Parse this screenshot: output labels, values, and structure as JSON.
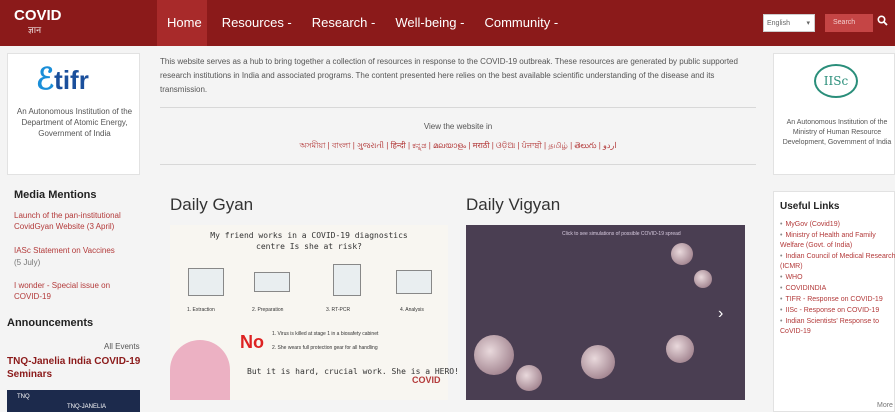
{
  "logo": {
    "text": "COVID",
    "sub": "ज्ञान"
  },
  "nav": {
    "items": [
      "Home",
      "Resources -",
      "Research -",
      "Well-being -",
      "Community -"
    ]
  },
  "header": {
    "language": "English",
    "search_placeholder": "Search",
    "search_icon": "search-icon"
  },
  "tifr": {
    "brand": "tifr",
    "description": "An Autonomous Institution of the Department of Atomic Energy, Government of India"
  },
  "media": {
    "title": "Media Mentions",
    "item1": "Launch of the pan-institutional CovidGyan Website (3 April)",
    "item2": "IASc Statement on Vaccines",
    "item2_date": "(5 July)",
    "item3": "I wonder - Special issue on COVID-19"
  },
  "announcements": {
    "title": "Announcements",
    "all_events": "All Events",
    "seminar": "TNQ-Janelia India COVID-19 Seminars",
    "banner_tnq": "TNQ",
    "banner_janelia": "TNQ-JANELIA"
  },
  "intro": "This website serves as a hub to bring together a collection of resources in response to the COVID-19 outbreak. These resources are generated by public supported research institutions in India and associated programs. The content presented here relies on the best available scientific understanding of the disease and its transmission.",
  "view_label": "View the website in",
  "languages": "অসমীয়া | বাংলা | ગુજરાતી | हिन्दी | ಕನ್ನಡ | മലയാളം | मराठी | ଓଡ଼ିଆ | ਪੰਜਾਬੀ | தமிழ் | తెలుగు | اردو",
  "daily_gyan": {
    "title": "Daily Gyan",
    "question": "My friend works in a COVID-19 diagnostics centre Is she at risk?",
    "steps": [
      "1. Extraction",
      "2. Preparation",
      "3. RT-PCR",
      "4. Analysis"
    ],
    "no": "No",
    "bullet1": "1. Virus is killed at stage 1 in a biosafety cabinet",
    "bullet2": "2. She wears full protection gear for all handling",
    "hero": "But it is hard, crucial work. She is a HERO!",
    "logo": "COVID"
  },
  "daily_vigyan": {
    "title": "Daily Vigyan",
    "caption": "Click to see simulations of possible COVID-19 spread"
  },
  "iisc": {
    "mark": "IISc",
    "description": "An Autonomous Institution of the Ministry of Human Resource Development, Government of India"
  },
  "useful_links": {
    "title": "Useful Links",
    "items": [
      "MyGov (Covid19)",
      "Ministry of Health and Family Welfare (Govt. of India)",
      "Indian Council of Medical Research (ICMR)",
      "WHO",
      "COVIDINDIA",
      "TIFR - Response on COVID-19",
      "IISc - Response on COVID-19",
      "Indian Scientists' Response to CoVID-19"
    ],
    "more": "More"
  },
  "colors": {
    "brand": "#8b1a1a",
    "link": "#b33a3a"
  }
}
